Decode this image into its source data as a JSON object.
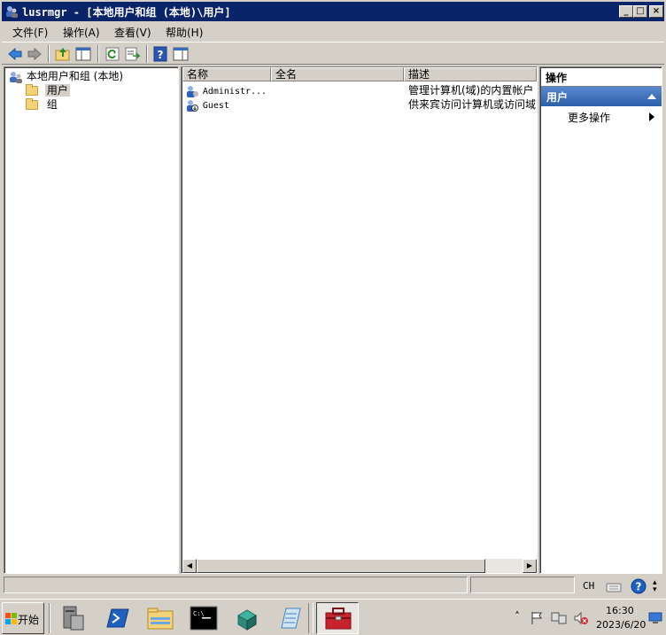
{
  "window": {
    "title": "lusrmgr - [本地用户和组 (本地)\\用户]",
    "minimize": "_",
    "maximize": "□",
    "close": "×"
  },
  "menu": {
    "items": [
      "文件(F)",
      "操作(A)",
      "查看(V)",
      "帮助(H)"
    ]
  },
  "toolbar": {
    "icons": [
      "back-icon",
      "forward-icon",
      "up-folder-icon",
      "show-hide-tree-icon",
      "refresh-icon",
      "export-list-icon",
      "help-icon",
      "action-pane-icon"
    ]
  },
  "tree": {
    "root": "本地用户和组 (本地)",
    "children": [
      "用户",
      "组"
    ],
    "selected": "用户"
  },
  "list": {
    "columns": [
      "名称",
      "全名",
      "描述"
    ],
    "rows": [
      {
        "name": "Administr...",
        "fullname": "",
        "description": "管理计算机(域)的内置帐户",
        "icon": "admin-user-icon"
      },
      {
        "name": "Guest",
        "fullname": "",
        "description": "供来宾访问计算机或访问域",
        "icon": "guest-user-icon"
      }
    ]
  },
  "actions": {
    "header": "操作",
    "section": "用户",
    "more": "更多操作"
  },
  "statusbar": {
    "lang": "CH"
  },
  "taskbar": {
    "start_label": "开始",
    "time": "16:30",
    "date": "2023/6/20"
  },
  "colors": {
    "title_bar": "#0a246a",
    "action_section": "#2b5fa8",
    "selected_tree": "#d4d0c8"
  }
}
